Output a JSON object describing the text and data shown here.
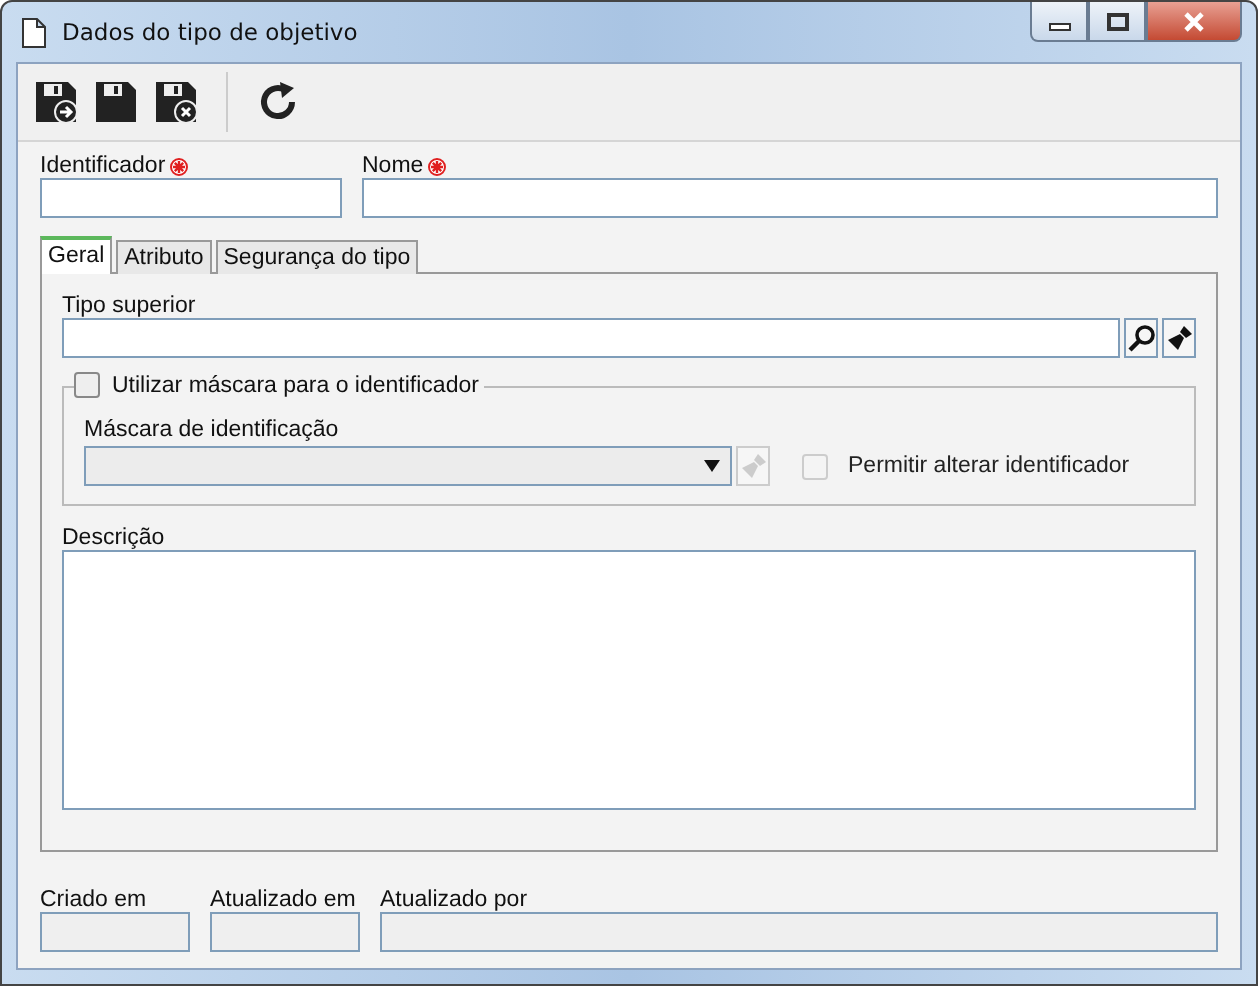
{
  "window": {
    "title": "Dados do tipo de objetivo"
  },
  "toolbar": [
    {
      "kind": "save-new"
    },
    {
      "kind": "save"
    },
    {
      "kind": "save-close"
    },
    {
      "kind": "separator"
    },
    {
      "kind": "refresh"
    }
  ],
  "top_fields": [
    {
      "label": "Identificador",
      "required": true
    },
    {
      "label": "Nome",
      "required": true
    }
  ],
  "tabs": [
    {
      "label": "Geral",
      "selected": true
    },
    {
      "label": "Atributo",
      "selected": false
    },
    {
      "label": "Segurança do tipo",
      "selected": false
    }
  ],
  "tipo_superior": {
    "label": "Tipo superior"
  },
  "mask_group": {
    "label": "Utilizar máscara para o identificador",
    "checked": false,
    "mask_label": "Máscara de identificação",
    "mask_disabled": true,
    "allow_label": "Permitir alterar identificador",
    "allow_checked": false,
    "allow_disabled": true
  },
  "descricao": {
    "label": "Descrição"
  },
  "footer_fields": [
    {
      "label": "Criado em"
    },
    {
      "label": "Atualizado em"
    },
    {
      "label": "Atualizado por"
    }
  ]
}
